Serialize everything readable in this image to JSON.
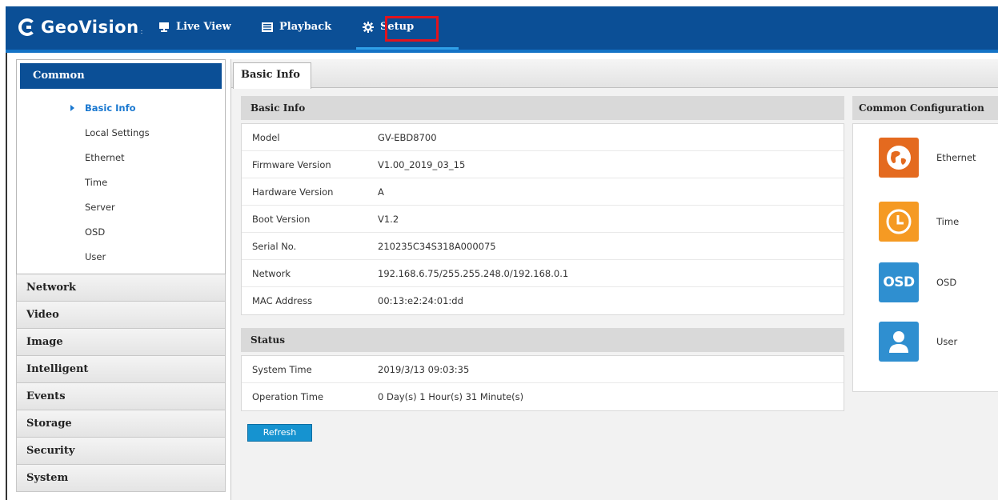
{
  "brand": {
    "name": "GeoVision",
    "tm": ":"
  },
  "nav": {
    "tabs": [
      {
        "label": "Live View",
        "icon": "monitor-icon"
      },
      {
        "label": "Playback",
        "icon": "playback-icon"
      },
      {
        "label": "Setup",
        "icon": "gear-icon",
        "active": true
      }
    ]
  },
  "sidebar": {
    "open_group": "Common",
    "common_items": [
      {
        "label": "Basic Info",
        "active": true
      },
      {
        "label": "Local Settings"
      },
      {
        "label": "Ethernet"
      },
      {
        "label": "Time"
      },
      {
        "label": "Server"
      },
      {
        "label": "OSD"
      },
      {
        "label": "User"
      }
    ],
    "groups": [
      "Network",
      "Video",
      "Image",
      "Intelligent",
      "Events",
      "Storage",
      "Security",
      "System"
    ]
  },
  "main": {
    "tab_label": "Basic Info",
    "basic_info": {
      "heading": "Basic Info",
      "rows": [
        {
          "label": "Model",
          "value": "GV-EBD8700"
        },
        {
          "label": "Firmware Version",
          "value": "V1.00_2019_03_15"
        },
        {
          "label": "Hardware Version",
          "value": "A"
        },
        {
          "label": "Boot Version",
          "value": "V1.2"
        },
        {
          "label": "Serial No.",
          "value": "210235C34S318A000075"
        },
        {
          "label": "Network",
          "value": "192.168.6.75/255.255.248.0/192.168.0.1"
        },
        {
          "label": "MAC Address",
          "value": "00:13:e2:24:01:dd"
        }
      ]
    },
    "status": {
      "heading": "Status",
      "rows": [
        {
          "label": "System Time",
          "value": "2019/3/13 09:03:35"
        },
        {
          "label": "Operation Time",
          "value": "0 Day(s) 1 Hour(s) 31 Minute(s)"
        }
      ]
    },
    "refresh_label": "Refresh"
  },
  "common_config": {
    "heading": "Common Configuration",
    "items": [
      {
        "label": "Ethernet",
        "icon": "globe-icon"
      },
      {
        "label": "Time",
        "icon": "clock-icon"
      },
      {
        "label": "OSD",
        "icon": "osd-icon",
        "icon_text": "OSD"
      },
      {
        "label": "User",
        "icon": "user-icon"
      }
    ]
  },
  "colors": {
    "header_blue": "#0b4f96",
    "highlight_red": "#e1141e",
    "active_link": "#1a78d0",
    "refresh_button": "#1693d0"
  }
}
